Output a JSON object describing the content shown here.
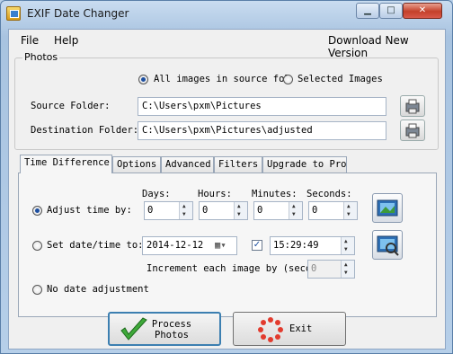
{
  "window": {
    "title": "EXIF Date Changer"
  },
  "menu": {
    "file_label": "File",
    "help_label": "Help",
    "download_link": "Download New Version"
  },
  "photos": {
    "group_label": "Photos",
    "all_images_label": "All images in source fol",
    "selected_images_label": "Selected Images",
    "source_label": "Source Folder:",
    "source_value": "C:\\Users\\pxm\\Pictures",
    "destination_label": "Destination Folder:",
    "destination_value": "C:\\Users\\pxm\\Pictures\\adjusted"
  },
  "tabs": [
    {
      "label": "Time Difference"
    },
    {
      "label": "Options"
    },
    {
      "label": "Advanced"
    },
    {
      "label": "Filters"
    },
    {
      "label": "Upgrade to Pro"
    }
  ],
  "time_difference": {
    "days_label": "Days:",
    "hours_label": "Hours:",
    "minutes_label": "Minutes:",
    "seconds_label": "Seconds:",
    "adjust_label": "Adjust time by:",
    "days_value": "0",
    "hours_value": "0",
    "minutes_value": "0",
    "seconds_value": "0",
    "set_date_label": "Set date/time to:",
    "date_value": "2014-12-12",
    "time_value": "15:29:49",
    "increment_label": "Increment each image by (secon",
    "increment_value": "0",
    "no_adjust_label": "No date adjustment"
  },
  "buttons": {
    "process_line1": "Process",
    "process_line2": "Photos",
    "exit_label": "Exit"
  },
  "colors": {
    "accent": "#3c7fb1",
    "radio_dot": "#1d4fa0",
    "close_red": "#c4402a"
  }
}
